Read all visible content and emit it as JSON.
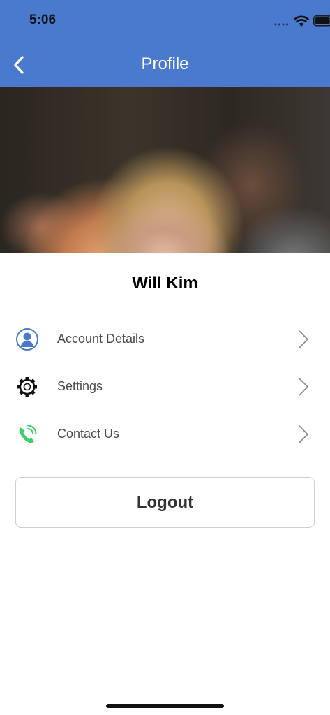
{
  "status_bar": {
    "time": "5:06"
  },
  "header": {
    "title": "Profile",
    "back_icon": "chevron-left-icon"
  },
  "profile": {
    "name": "Will Kim"
  },
  "menu": [
    {
      "label": "Account Details",
      "icon": "user-avatar-icon"
    },
    {
      "label": "Settings",
      "icon": "gear-icon"
    },
    {
      "label": "Contact Us",
      "icon": "phone-icon"
    }
  ],
  "logout": {
    "label": "Logout"
  },
  "colors": {
    "header": "#4a7acd",
    "phone_icon": "#3ecf6b",
    "account_icon": "#4a7acd"
  }
}
